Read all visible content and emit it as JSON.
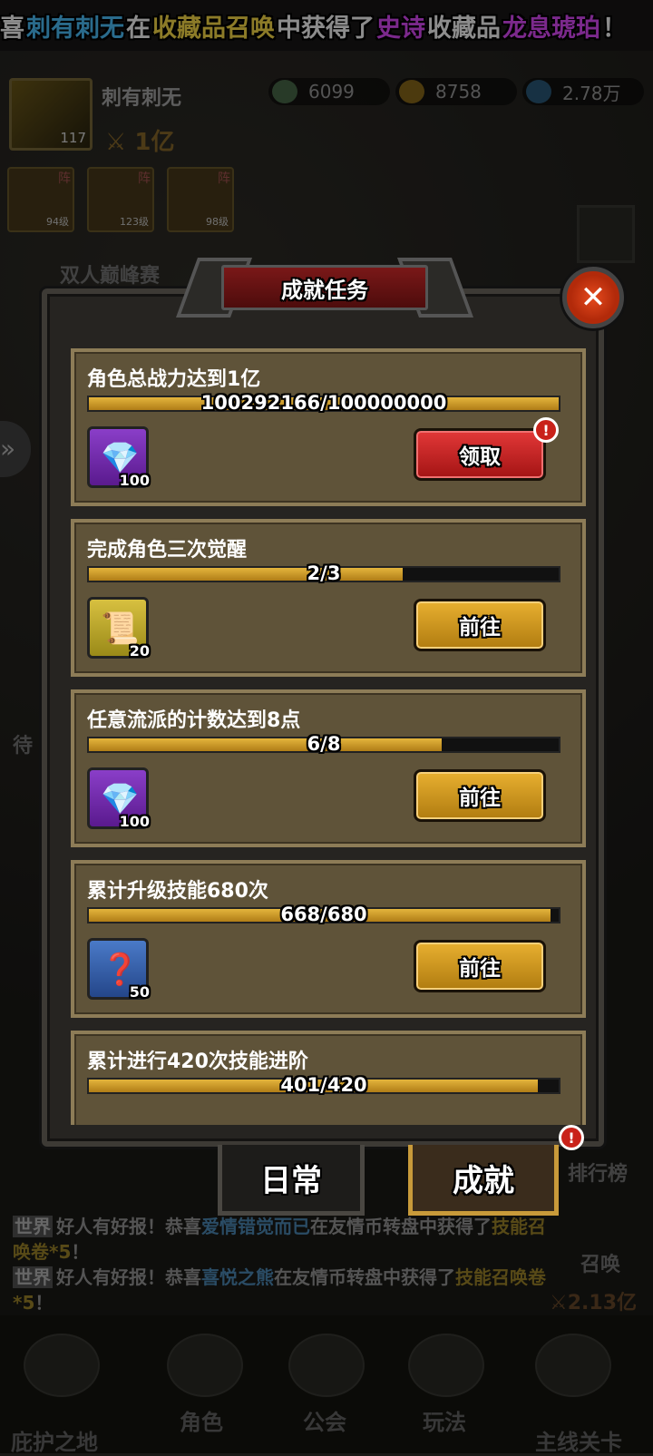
{
  "ticker": {
    "prefix": "喜",
    "player": "刺有刺无",
    "mid1": "在",
    "source": "收藏品召唤",
    "mid2": "中获得了",
    "rarity": "史诗",
    "mid3": "收藏品",
    "item": "龙息琥珀",
    "end": "！"
  },
  "player": {
    "name": "刺有刺无",
    "level": "117",
    "power": "1亿"
  },
  "resources": [
    {
      "icon": "green-coin-icon",
      "value": "6099"
    },
    {
      "icon": "gold-coin-icon",
      "value": "8758"
    },
    {
      "icon": "blue-gem-icon",
      "value": "2.78万"
    }
  ],
  "team": [
    {
      "tag": "阵",
      "level": "94级"
    },
    {
      "tag": "阵",
      "level": "123级"
    },
    {
      "tag": "阵",
      "level": "98级"
    }
  ],
  "event_label": "双人巅峰赛",
  "modal": {
    "title": "成就任务",
    "close_icon": "close-icon"
  },
  "tasks": [
    {
      "title": "角色总战力达到1亿",
      "progress_text": "100292166/100000000",
      "progress": 1.0,
      "reward_icon": "diamond-icon",
      "reward_count": "100",
      "reward_bg": "purple",
      "button": "领取",
      "button_style": "red",
      "alert": true
    },
    {
      "title": "完成角色三次觉醒",
      "progress_text": "2/3",
      "progress": 0.667,
      "reward_icon": "scroll-icon",
      "reward_count": "20",
      "reward_bg": "gold",
      "button": "前往",
      "button_style": "gold",
      "alert": false
    },
    {
      "title": "任意流派的计数达到8点",
      "progress_text": "6/8",
      "progress": 0.75,
      "reward_icon": "diamond-icon",
      "reward_count": "100",
      "reward_bg": "purple",
      "button": "前往",
      "button_style": "gold",
      "alert": false
    },
    {
      "title": "累计升级技能680次",
      "progress_text": "668/680",
      "progress": 0.982,
      "reward_icon": "skill-card-icon",
      "reward_count": "50",
      "reward_bg": "blue",
      "button": "前往",
      "button_style": "gold",
      "alert": false
    },
    {
      "title": "累计进行420次技能进阶",
      "progress_text": "401/420",
      "progress": 0.955
    }
  ],
  "tabs": {
    "daily": "日常",
    "achievement": "成就"
  },
  "side": {
    "ranking": "排行榜",
    "summon": "召唤",
    "power": "2.13亿",
    "wait": "待"
  },
  "chat": [
    {
      "tag": "世界",
      "text": "好人有好报！恭喜",
      "name": "爱情错觉而已",
      "text2": "在友情币转盘中获得了",
      "item": "技能召唤卷",
      "count": "*5",
      "end": "！"
    },
    {
      "tag": "世界",
      "text": "好人有好报！恭喜",
      "name": "喜悦之熊",
      "text2": "在友情币转盘中获得了",
      "item": "技能召唤卷",
      "count": "*5",
      "end": "！"
    }
  ],
  "nav": [
    "庇护之地",
    "角色",
    "公会",
    "玩法",
    "主线关卡"
  ],
  "colors": {
    "accent_gold": "#e4b53c",
    "button_red": "#c9221a",
    "ticker_blue": "#4ec3ff",
    "ticker_yellow": "#ffe14a",
    "ticker_pink": "#e04bff"
  }
}
